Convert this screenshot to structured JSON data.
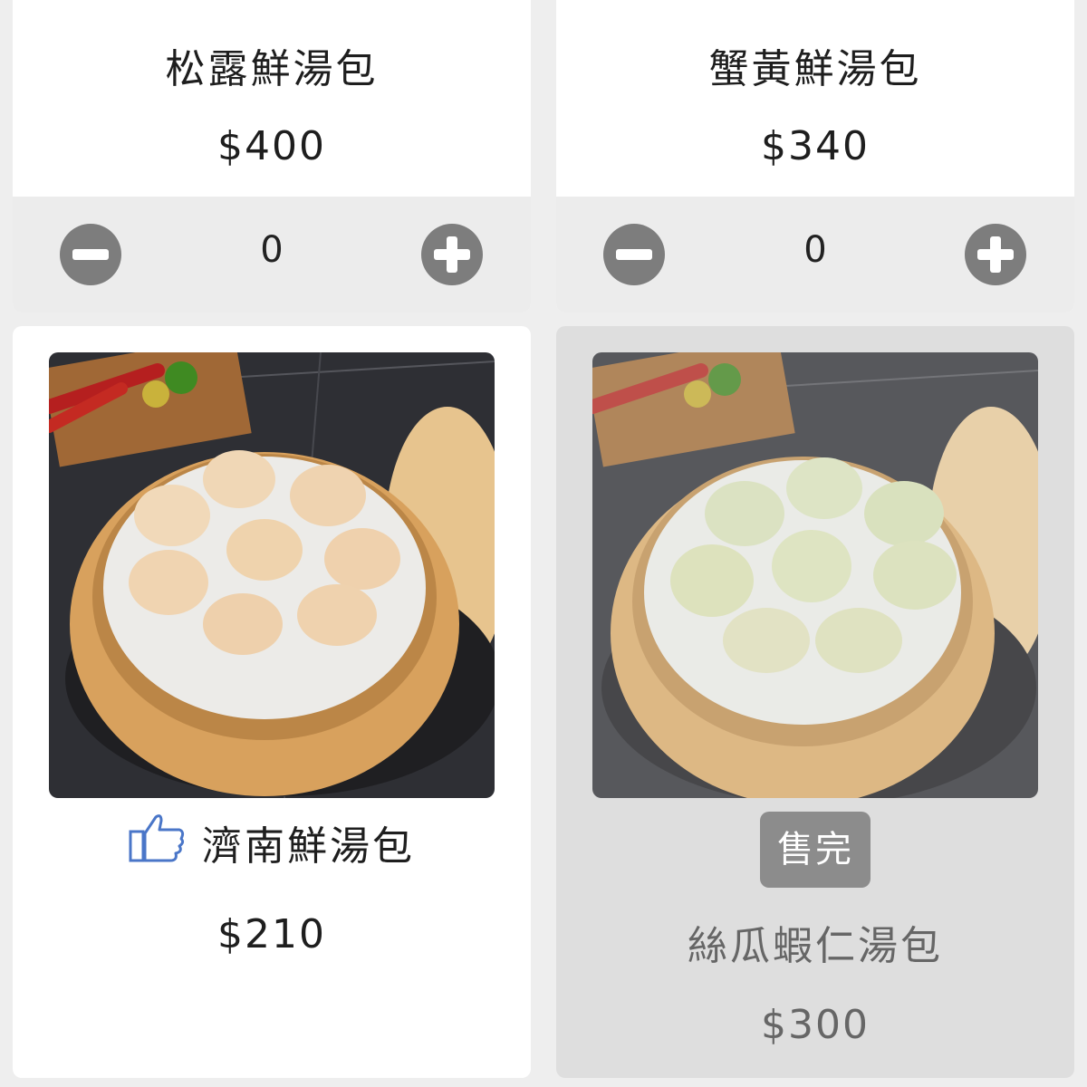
{
  "products": [
    {
      "name": "松露鮮湯包",
      "price": "$400",
      "quantity": "0"
    },
    {
      "name": "蟹黃鮮湯包",
      "price": "$340",
      "quantity": "0"
    },
    {
      "name": "濟南鮮湯包",
      "price": "$210",
      "recommended_icon": "thumbs-up-icon"
    },
    {
      "name": "絲瓜蝦仁湯包",
      "price": "$300",
      "badge": "售完"
    }
  ],
  "icons": {
    "decrement": "minus-circle-icon",
    "increment": "plus-circle-icon"
  },
  "colors": {
    "card": "#ffffff",
    "soldout_card": "#dedede",
    "stepper_bg": "#ececec",
    "button": "#7d7d7d",
    "badge": "#8c8c8c",
    "thumb": "#4a76c8"
  }
}
